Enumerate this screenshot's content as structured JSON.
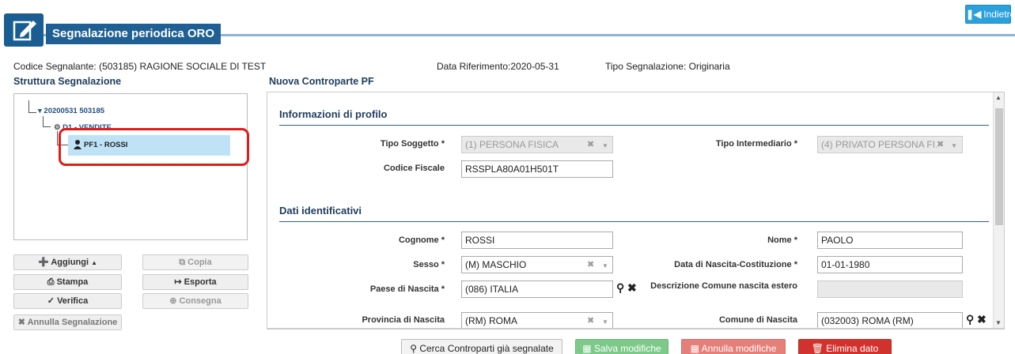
{
  "header": {
    "title": "Segnalazione periodica ORO",
    "back_label": "Indietro"
  },
  "info": {
    "codice_segnalante": "Codice Segnalante: (503185) RAGIONE SOCIALE DI TEST",
    "data_riferimento": "Data Riferimento:2020-05-31",
    "tipo_segnalazione": "Tipo Segnalazione: Originaria"
  },
  "left": {
    "section_title": "Struttura Segnalazione",
    "tree": {
      "root": "20200531 503185",
      "child": "D1 - VENDITE",
      "leaf": "PF1 - ROSSI"
    },
    "buttons": {
      "aggiungi": "Aggiungi",
      "copia": "Copia",
      "stampa": "Stampa",
      "esporta": "Esporta",
      "verifica": "Verifica",
      "consegna": "Consegna",
      "annulla_segnalazione": "Annulla Segnalazione"
    }
  },
  "form": {
    "title": "Nuova Controparte PF",
    "section_profile": "Informazioni di profilo",
    "section_ident": "Dati identificativi",
    "fields": {
      "tipo_soggetto": {
        "label": "Tipo Soggetto *",
        "value": "(1) PERSONA FISICA"
      },
      "tipo_intermediario": {
        "label": "Tipo Intermediario *",
        "value": "(4) PRIVATO PERSONA FI..."
      },
      "codice_fiscale": {
        "label": "Codice Fiscale",
        "value": "RSSPLA80A01H501T"
      },
      "cognome": {
        "label": "Cognome *",
        "value": "ROSSI"
      },
      "nome": {
        "label": "Nome *",
        "value": "PAOLO"
      },
      "sesso": {
        "label": "Sesso *",
        "value": "(M) MASCHIO"
      },
      "data_nascita": {
        "label": "Data di Nascita-Costituzione *",
        "value": "01-01-1980"
      },
      "paese_nascita": {
        "label": "Paese di Nascita *",
        "value": "(086) ITALIA"
      },
      "desc_comune_estero": {
        "label": "Descrizione Comune nascita estero",
        "value": ""
      },
      "provincia_nascita": {
        "label": "Provincia di Nascita",
        "value": "(RM) ROMA"
      },
      "comune_nascita": {
        "label": "Comune di Nascita",
        "value": "(032003) ROMA (RM)"
      }
    }
  },
  "actions": {
    "cerca": "Cerca Controparti già segnalate",
    "salva": "Salva modifiche",
    "annulla": "Annulla modifiche",
    "elimina": "Elimina dato"
  }
}
